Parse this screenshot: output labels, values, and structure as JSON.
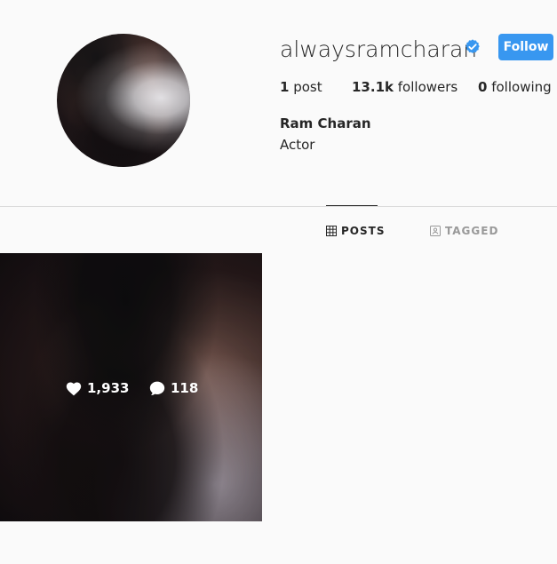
{
  "profile": {
    "username": "alwaysramcharan",
    "verified": true,
    "follow_label": "Follow",
    "full_name": "Ram Charan",
    "bio": "Actor"
  },
  "stats": {
    "posts": {
      "count": "1",
      "label": "post"
    },
    "followers": {
      "count": "13.1k",
      "label": "followers"
    },
    "following": {
      "count": "0",
      "label": "following"
    }
  },
  "tabs": {
    "posts": "POSTS",
    "tagged": "TAGGED"
  },
  "post": {
    "likes": "1,933",
    "comments": "118"
  },
  "icons": {
    "verified": "verified-icon",
    "posts_tab": "grid-icon",
    "tagged_tab": "tagged-icon",
    "likes": "heart-icon",
    "comments": "comment-icon"
  },
  "colors": {
    "accent": "#3897f0",
    "text": "#262626",
    "muted": "#999999",
    "background": "#fafafa",
    "divider": "#dbdbdb"
  }
}
